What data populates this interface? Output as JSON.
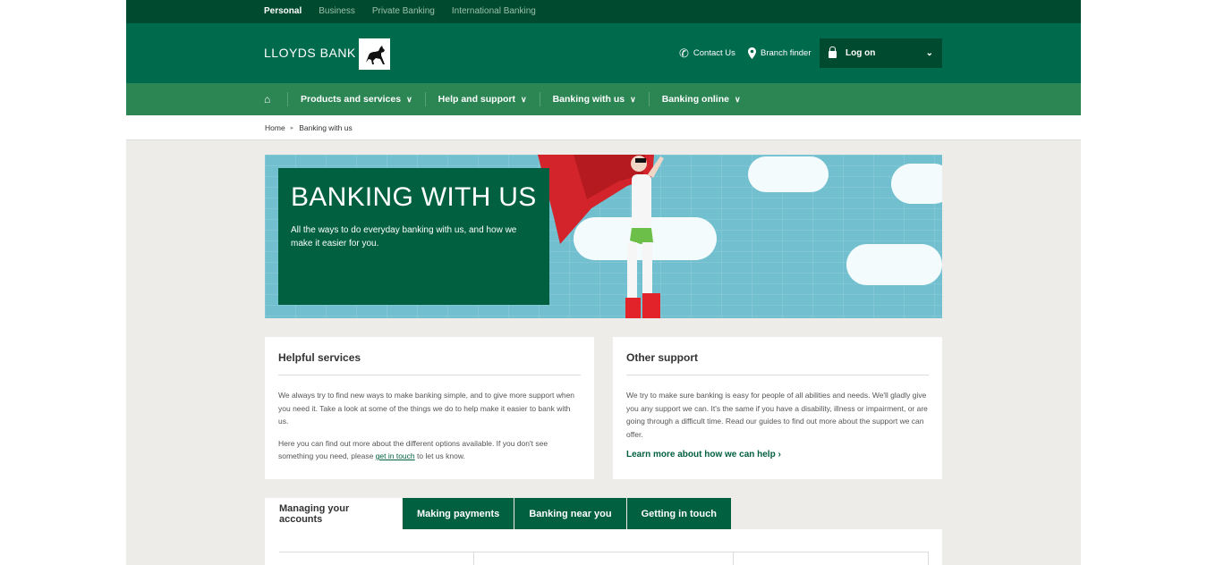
{
  "topbar": {
    "links": [
      "Personal",
      "Business",
      "Private Banking",
      "International Banking"
    ]
  },
  "header": {
    "logo_text": "LLOYDS BANK",
    "contact": "Contact Us",
    "branch": "Branch finder",
    "logon": "Log on"
  },
  "nav": {
    "items": [
      "Products and services",
      "Help and support",
      "Banking with us",
      "Banking online"
    ]
  },
  "breadcrumb": {
    "home": "Home",
    "current": "Banking with us"
  },
  "hero": {
    "title": "BANKING WITH US",
    "text": "All the ways to do everyday banking with us, and how we make it easier for you."
  },
  "helpful": {
    "title": "Helpful services",
    "p1": "We always try to find new ways to make banking simple, and to give more support when you need it. Take a look at some of the things we do to help make it easier to bank with us.",
    "p2_before": "Here you can find out more about the different options available. If you don't see something you need, please ",
    "p2_link": "get in touch",
    "p2_after": " to let us know."
  },
  "other": {
    "title": "Other support",
    "p1": "We try to make sure banking is easy for people of all abilities and needs. We'll gladly give you any support we can. It's the same if you have a disability, illness or impairment, or are going through a difficult time. Read our guides to find out more about the support we can offer.",
    "link": "Learn more about how we can help"
  },
  "tabs": [
    "Managing your accounts",
    "Making payments",
    "Banking near you",
    "Getting in touch"
  ],
  "colors": {
    "dark_green": "#004a2f",
    "brand_green": "#006a4d",
    "nav_green": "#2c8654",
    "panel_green": "#00603f"
  }
}
